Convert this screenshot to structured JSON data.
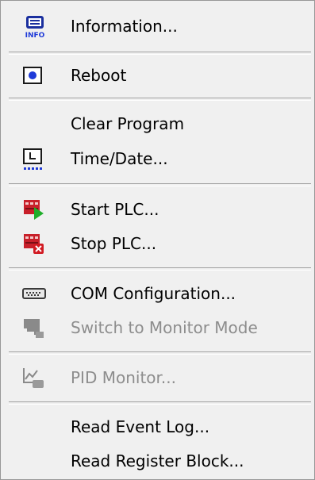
{
  "menu": {
    "items": [
      {
        "label": "Information...",
        "icon": "info-icon",
        "enabled": true
      },
      {
        "label": "Reboot",
        "icon": "reboot-icon",
        "enabled": true
      },
      {
        "label": "Clear Program",
        "icon": "",
        "enabled": true
      },
      {
        "label": "Time/Date...",
        "icon": "clock-icon",
        "enabled": true
      },
      {
        "label": "Start PLC...",
        "icon": "start-plc-icon",
        "enabled": true
      },
      {
        "label": "Stop PLC...",
        "icon": "stop-plc-icon",
        "enabled": true
      },
      {
        "label": "COM Configuration...",
        "icon": "com-port-icon",
        "enabled": true
      },
      {
        "label": "Switch to Monitor Mode",
        "icon": "monitor-mode-icon",
        "enabled": false
      },
      {
        "label": "PID Monitor...",
        "icon": "pid-monitor-icon",
        "enabled": false
      },
      {
        "label": "Read Event Log...",
        "icon": "",
        "enabled": true
      },
      {
        "label": "Read Register Block...",
        "icon": "",
        "enabled": true
      }
    ],
    "info_icon_text": "INFO"
  },
  "colors": {
    "background": "#f0f0f0",
    "disabled_text": "#8d8d8d",
    "accent_blue": "#1e3ad8",
    "plc_red": "#c8202a",
    "start_green": "#1fae2a"
  }
}
